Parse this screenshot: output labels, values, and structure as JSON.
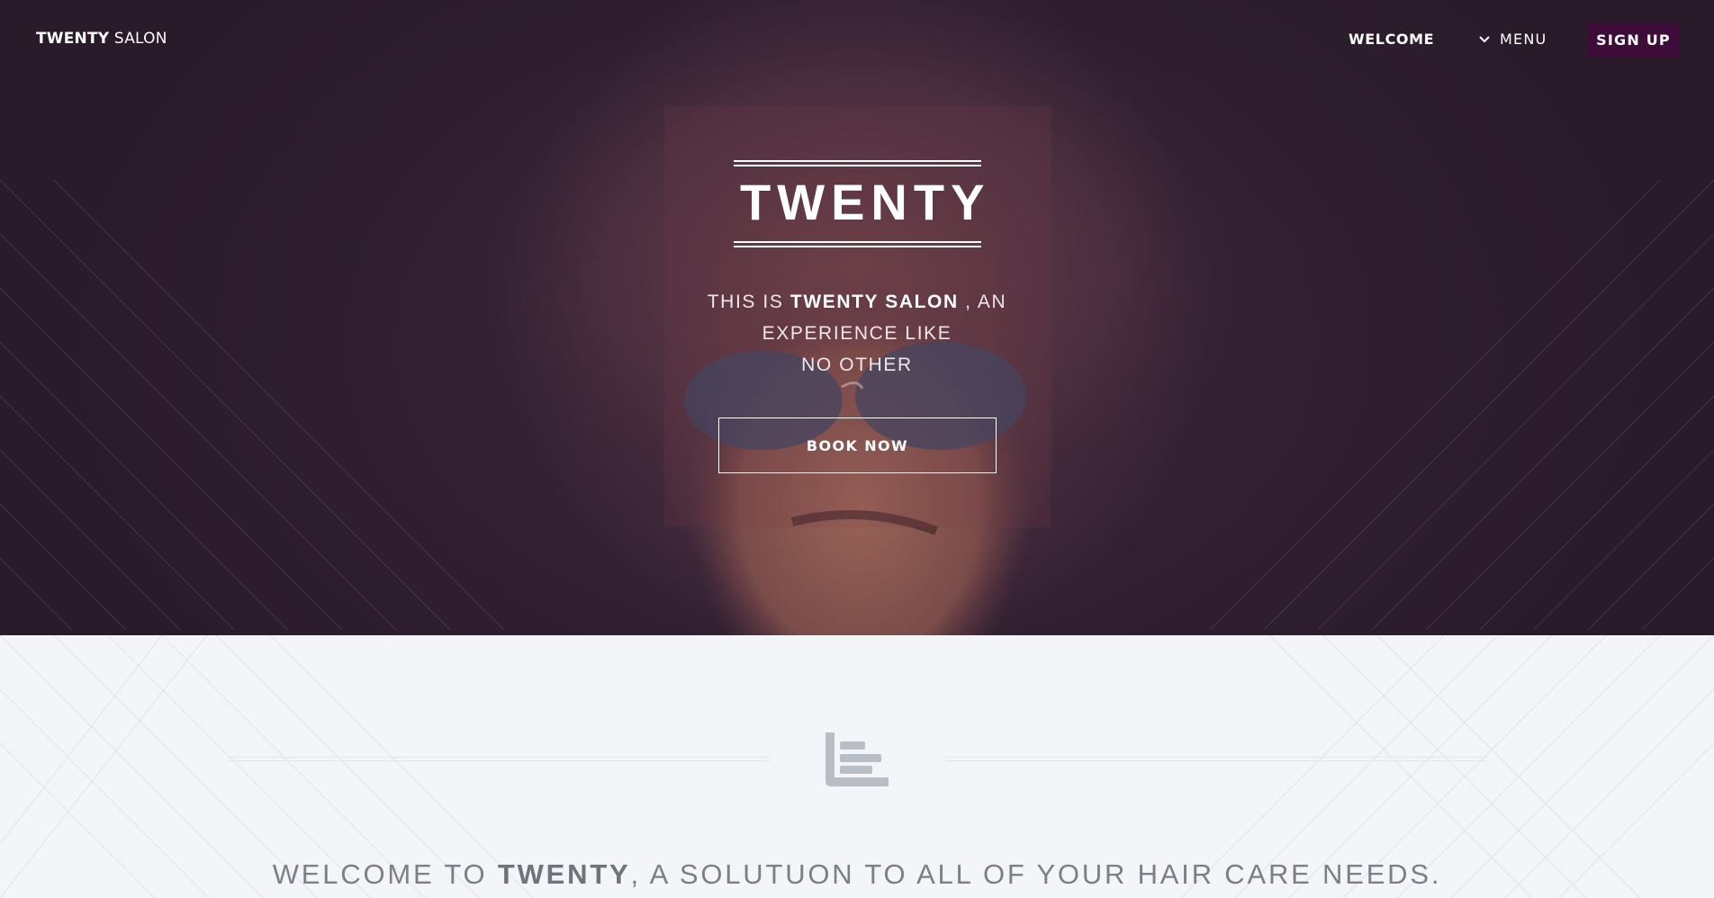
{
  "brand": {
    "name_strong": "TWENTY",
    "name_light": "SALON"
  },
  "nav": {
    "welcome": "WELCOME",
    "menu": "MENU",
    "signup": "SIGN UP"
  },
  "hero": {
    "title": "TWENTY",
    "sub_prefix": "THIS IS ",
    "sub_strong": "TWENTY SALON",
    "sub_suffix_line1": " , AN",
    "sub_line2": "EXPERIENCE LIKE",
    "sub_line3": "NO OTHER",
    "cta": "BOOK NOW"
  },
  "intro": {
    "prefix": "WELCOME TO ",
    "strong": "TWENTY",
    "suffix": ", A SOLUTUON TO ALL OF YOUR HAIR CARE NEEDS."
  },
  "icons": {
    "menu_chevron": "chevron-down-icon",
    "section_icon": "bar-chart-icon"
  },
  "colors": {
    "hero_bg": "#2f1f30",
    "signup_bg": "#3d0c38",
    "lower_bg": "#f3f5f9",
    "intro_text": "#7b7f87"
  }
}
